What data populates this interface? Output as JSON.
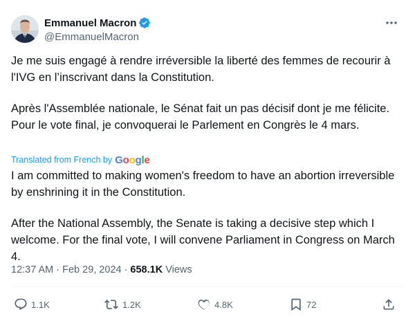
{
  "author": {
    "name": "Emmanuel Macron",
    "handle": "@EmmanuelMacron",
    "verified_color": "#1d9bf0"
  },
  "tweet": {
    "original_paragraphs": [
      "Je me suis engagé à rendre irréversible la liberté des femmes de recourir à l'IVG en l’inscrivant dans la Constitution.",
      "Après l'Assemblée nationale, le Sénat fait un pas décisif dont je me félicite. Pour le vote final, je convoquerai le Parlement en Congrès le 4 mars."
    ],
    "translated_label": "Translated from French by",
    "translator_brand": [
      "G",
      "o",
      "o",
      "g",
      "l",
      "e"
    ],
    "translation_paragraphs": [
      "I am committed to making women's freedom to have an abortion irreversible by enshrining it in the Constitution.",
      "After the National Assembly, the Senate is taking a decisive step which I welcome. For the final vote, I will convene Parliament in Congress on March 4."
    ]
  },
  "meta": {
    "time": "12:37 AM",
    "separator1": "·",
    "date": "Feb 29, 2024",
    "separator2": "·",
    "views_count": "658.1K",
    "views_label": "Views"
  },
  "actions": {
    "replies": "1.1K",
    "reposts": "1.2K",
    "likes": "4.8K",
    "bookmarks": "72"
  },
  "colors": {
    "text": "#0f1419",
    "muted": "#536471",
    "accent": "#1d9bf0",
    "google": [
      "#4285f4",
      "#ea4335",
      "#fbbc05",
      "#4285f4",
      "#34a853",
      "#ea4335"
    ]
  },
  "icons": {
    "verified": "verified-badge-icon",
    "more": "more-dots-icon",
    "reply": "reply-icon",
    "repost": "repost-icon",
    "like": "heart-icon",
    "bookmark": "bookmark-icon",
    "share": "share-icon"
  }
}
